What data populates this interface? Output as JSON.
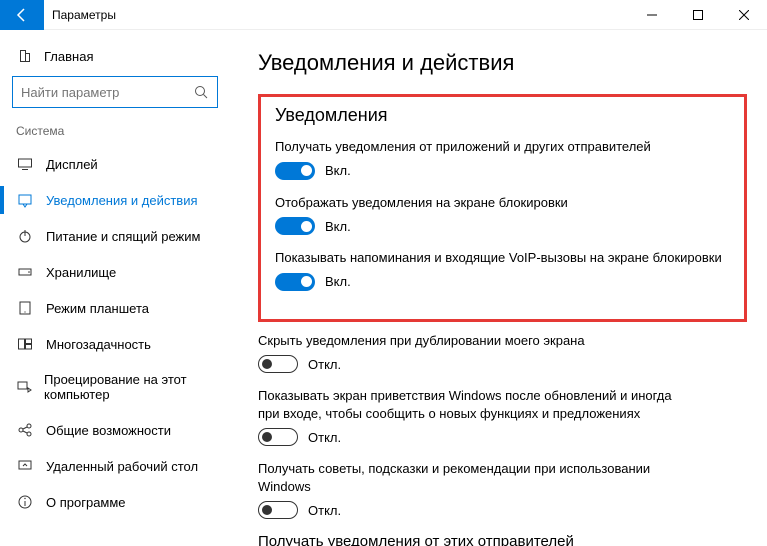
{
  "window": {
    "title": "Параметры"
  },
  "sidebar": {
    "home": "Главная",
    "search_placeholder": "Найти параметр",
    "group": "Система",
    "items": [
      {
        "label": "Дисплей"
      },
      {
        "label": "Уведомления и действия"
      },
      {
        "label": "Питание и спящий режим"
      },
      {
        "label": "Хранилище"
      },
      {
        "label": "Режим планшета"
      },
      {
        "label": "Многозадачность"
      },
      {
        "label": "Проецирование на этот компьютер"
      },
      {
        "label": "Общие возможности"
      },
      {
        "label": "Удаленный рабочий стол"
      },
      {
        "label": "О программе"
      }
    ]
  },
  "content": {
    "title": "Уведомления и действия",
    "section_heading": "Уведомления",
    "settings": [
      {
        "label": "Получать уведомления от приложений и других отправителей",
        "on": true,
        "state": "Вкл."
      },
      {
        "label": "Отображать уведомления на экране блокировки",
        "on": true,
        "state": "Вкл."
      },
      {
        "label": "Показывать напоминания и входящие VoIP-вызовы на экране блокировки",
        "on": true,
        "state": "Вкл."
      },
      {
        "label": "Скрыть уведомления при дублировании моего экрана",
        "on": false,
        "state": "Откл."
      },
      {
        "label": "Показывать экран приветствия Windows после обновлений и иногда при входе, чтобы сообщить о новых функциях и предложениях",
        "on": false,
        "state": "Откл."
      },
      {
        "label": "Получать советы, подсказки и рекомендации при использовании Windows",
        "on": false,
        "state": "Откл."
      }
    ],
    "subheading": "Получать уведомления от этих отправителей"
  }
}
